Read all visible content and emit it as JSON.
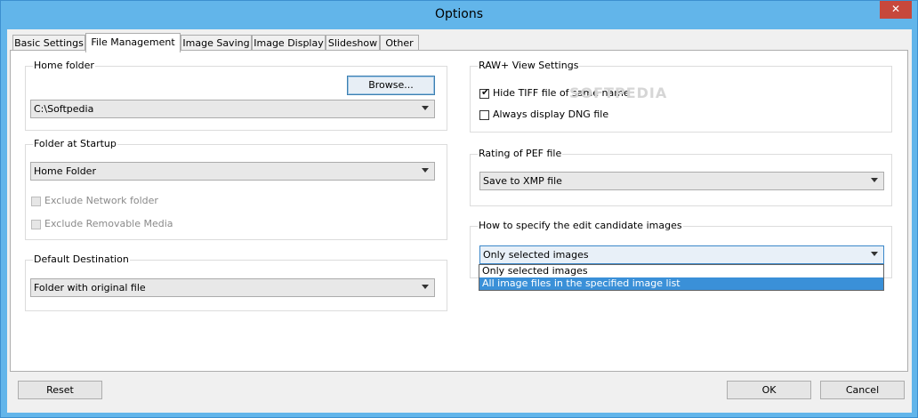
{
  "window": {
    "title": "Options",
    "close_glyph": "✕"
  },
  "tabs": [
    {
      "label": "Basic Settings"
    },
    {
      "label": "File Management"
    },
    {
      "label": "Image Saving"
    },
    {
      "label": "Image Display"
    },
    {
      "label": "Slideshow"
    },
    {
      "label": "Other"
    }
  ],
  "active_tab": "File Management",
  "home_folder": {
    "title": "Home folder",
    "browse_label": "Browse...",
    "path_value": "C:\\Softpedia"
  },
  "folder_startup": {
    "title": "Folder at Startup",
    "selected": "Home Folder",
    "exclude_network": {
      "label": "Exclude Network folder",
      "checked": false,
      "enabled": false
    },
    "exclude_removable": {
      "label": "Exclude Removable Media",
      "checked": false,
      "enabled": false
    }
  },
  "default_destination": {
    "title": "Default Destination",
    "selected": "Folder with original file"
  },
  "raw_view": {
    "title": "RAW+ View Settings",
    "hide_tiff": {
      "label": "Hide TIFF file of same name",
      "checked": true
    },
    "always_dng": {
      "label": "Always display DNG file",
      "checked": false
    }
  },
  "rating_pef": {
    "title": "Rating of PEF file",
    "selected": "Save to XMP file"
  },
  "edit_candidate": {
    "title": "How to specify the edit candidate images",
    "selected": "Only selected images",
    "options": [
      "Only selected images",
      "All image files in the specified image list"
    ],
    "highlighted_option": "All image files in the specified image list"
  },
  "watermark": "SOFTPEDIA",
  "footer": {
    "reset_label": "Reset",
    "ok_label": "OK",
    "cancel_label": "Cancel"
  }
}
